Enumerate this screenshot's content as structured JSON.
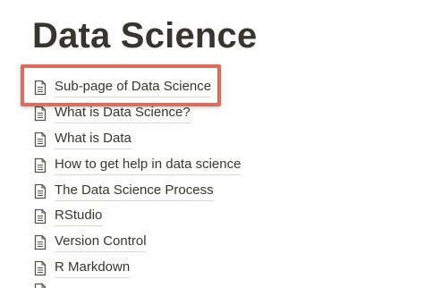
{
  "page": {
    "title": "Data Science"
  },
  "subpages": [
    {
      "label": "Sub-page of Data Science",
      "icon": "page-icon",
      "highlighted": true
    },
    {
      "label": "What is Data Science?",
      "icon": "page-icon"
    },
    {
      "label": "What is Data",
      "icon": "page-icon"
    },
    {
      "label": "How to get help in data science",
      "icon": "page-icon"
    },
    {
      "label": "The Data Science Process",
      "icon": "page-icon"
    },
    {
      "label": "RStudio",
      "icon": "page-icon"
    },
    {
      "label": "Version Control",
      "icon": "page-icon"
    },
    {
      "label": "R Markdown",
      "icon": "page-icon"
    }
  ],
  "colors": {
    "text": "#37352f",
    "highlight_border": "#d86e5f",
    "link_underline": "#d9d8d5"
  }
}
